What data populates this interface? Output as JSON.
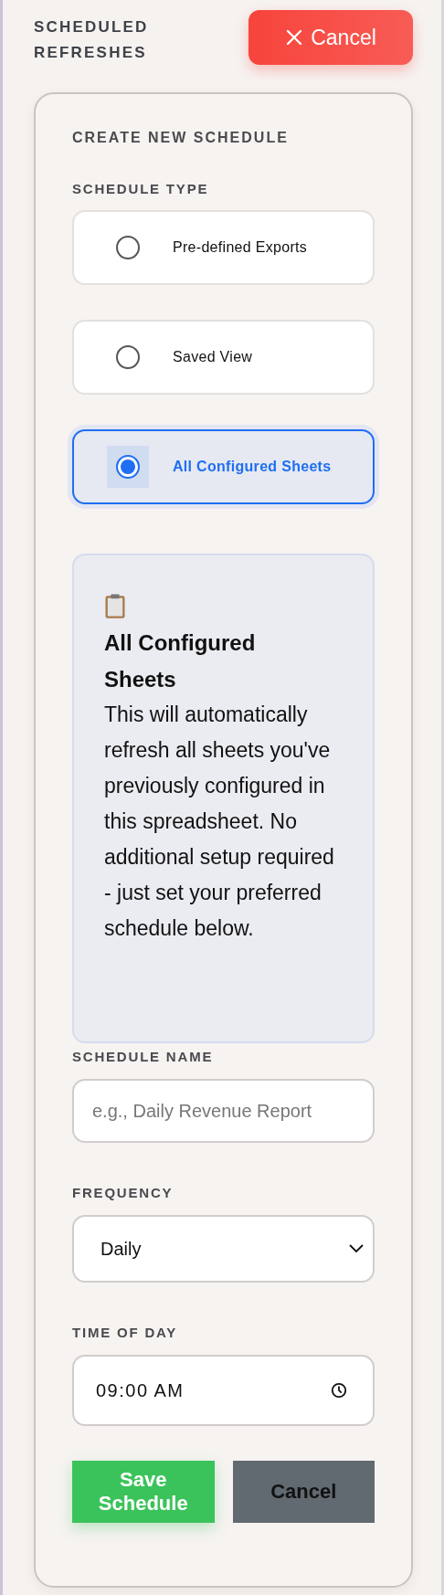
{
  "header": {
    "title": "SCHEDULED REFRESHES",
    "cancel_button": "Cancel"
  },
  "form": {
    "title": "CREATE NEW SCHEDULE",
    "schedule_type": {
      "label": "SCHEDULE TYPE",
      "options": [
        {
          "label": "Pre-defined Exports",
          "selected": false
        },
        {
          "label": "Saved View",
          "selected": false
        },
        {
          "label": "All Configured Sheets",
          "selected": true
        }
      ]
    },
    "info": {
      "heading": "All Configured Sheets",
      "text": "This will automatically refresh all sheets you've previously configured in this spreadsheet. No additional setup required - just set your preferred schedule below."
    },
    "schedule_name": {
      "label": "SCHEDULE NAME",
      "placeholder": "e.g., Daily Revenue Report"
    },
    "frequency": {
      "label": "FREQUENCY",
      "value": "Daily"
    },
    "time_of_day": {
      "label": "TIME OF DAY",
      "value": "09:00 AM"
    },
    "buttons": [
      {
        "label": "Save Schedule",
        "kind": "primary"
      },
      {
        "label": "Cancel",
        "kind": "secondary"
      }
    ]
  }
}
